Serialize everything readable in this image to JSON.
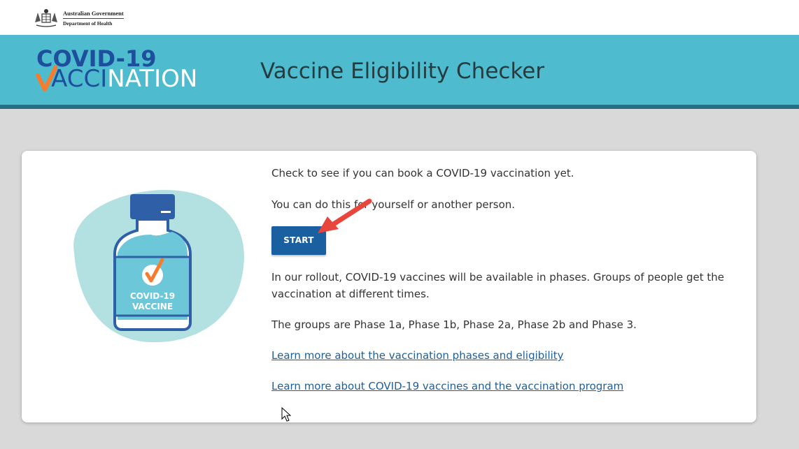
{
  "gov_header": {
    "line1": "Australian Government",
    "line2": "Department of Health"
  },
  "banner": {
    "logo_line1": "COVID-19",
    "logo_line2_acci": "ACCI",
    "logo_line2_nation": "NATION",
    "page_title": "Vaccine Eligibility Checker"
  },
  "illustration": {
    "label_line1": "COVID-19",
    "label_line2": "VACCINE"
  },
  "main": {
    "intro": "Check to see if you can book a COVID-19 vaccination yet.",
    "for_whom": "You can do this for yourself or another person.",
    "start_label": "START",
    "rollout_line1": "In our rollout, COVID-19 vaccines will be available in phases. Groups of people get the",
    "rollout_line2": "vaccination at different times.",
    "groups": "The groups are Phase 1a, Phase 1b, Phase 2a, Phase 2b and Phase 3.",
    "link_phases": "Learn more about the vaccination phases and eligibility",
    "link_vaccines": "Learn more about COVID-19 vaccines and the vaccination program"
  },
  "colors": {
    "banner": "#4ebcce",
    "banner_border": "#236f84",
    "button": "#1a5fa0",
    "link": "#1f5e96",
    "accent_check": "#f47c2c",
    "annotation_arrow": "#e8453c"
  }
}
